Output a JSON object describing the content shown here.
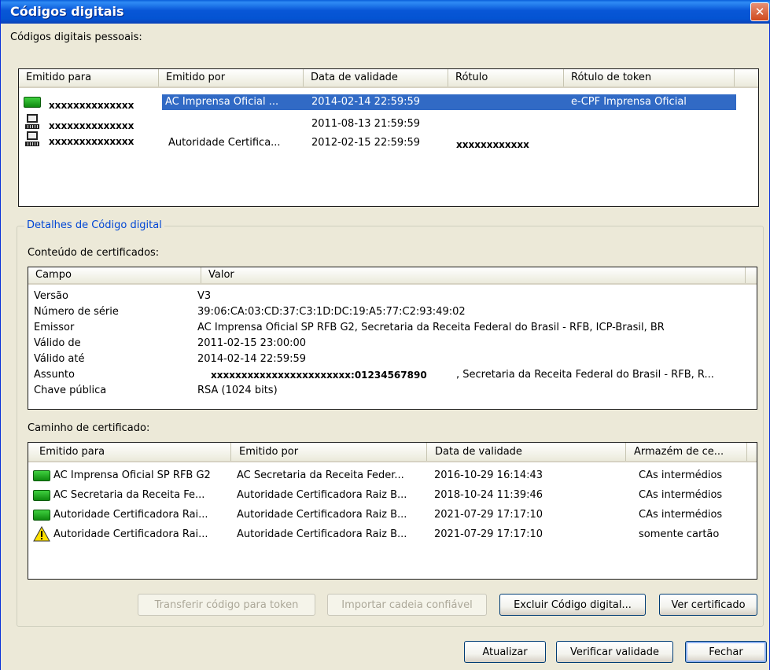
{
  "window": {
    "title": "Códigos digitais",
    "close_glyph": "✕"
  },
  "personal": {
    "label": "Códigos digitais pessoais:",
    "columns": [
      "Emitido para",
      "Emitido por",
      "Data de validade",
      "Rótulo",
      "Rótulo de token"
    ],
    "rows": [
      {
        "icon": "smartcard-icon",
        "issued_to": "xxxxxxxxxxxxxx",
        "issued_by": "AC Imprensa Oficial ...",
        "expires": "2014-02-14 22:59:59",
        "label": "",
        "token_label": "e-CPF Imprensa Oficial",
        "selected": true
      },
      {
        "icon": "computer-icon",
        "issued_to": "xxxxxxxxxxxxxx",
        "issued_by": "",
        "expires": "2011-08-13 21:59:59",
        "label": "",
        "token_label": "",
        "selected": false
      },
      {
        "icon": "computer-icon",
        "issued_to": "xxxxxxxxxxxxxx",
        "issued_by": "Autoridade Certifica...",
        "expires": "2012-02-15 22:59:59",
        "label": "xxxxxxxxxxxx",
        "token_label": "",
        "selected": false
      }
    ]
  },
  "details": {
    "group_title": "Detalhes de Código digital",
    "content_label": "Conteúdo de certificados:",
    "columns": [
      "Campo",
      "Valor"
    ],
    "fields": [
      {
        "field": "Versão",
        "value": "V3"
      },
      {
        "field": "Número de série",
        "value": "39:06:CA:03:CD:37:C3:1D:DC:19:A5:77:C2:93:49:02"
      },
      {
        "field": "Emissor",
        "value": "AC Imprensa Oficial SP RFB G2, Secretaria da Receita Federal do Brasil - RFB, ICP-Brasil, BR"
      },
      {
        "field": "Válido de",
        "value": "2011-02-15 23:00:00"
      },
      {
        "field": "Válido até",
        "value": "2014-02-14 22:59:59"
      },
      {
        "field": "Assunto",
        "value_masked": "xxxxxxxxxxxxxxxxxxxxxxx:01234567890",
        "value": ", Secretaria da Receita Federal do Brasil - RFB, R..."
      },
      {
        "field": "Chave pública",
        "value": "RSA (1024 bits)"
      }
    ],
    "path_label": "Caminho de certificado:",
    "path_columns": [
      "Emitido para",
      "Emitido por",
      "Data de validade",
      "Armazém de ce..."
    ],
    "path_rows": [
      {
        "icon": "smartcard-icon",
        "issued_to": "AC Imprensa Oficial SP RFB G2",
        "issued_by": "AC Secretaria da Receita Feder...",
        "expires": "2016-10-29 16:14:43",
        "store": "CAs intermédios"
      },
      {
        "icon": "smartcard-icon",
        "issued_to": "AC Secretaria da Receita Fe...",
        "issued_by": "Autoridade Certificadora Raiz B...",
        "expires": "2018-10-24 11:39:46",
        "store": "CAs intermédios"
      },
      {
        "icon": "smartcard-icon",
        "issued_to": "Autoridade Certificadora Rai...",
        "issued_by": "Autoridade Certificadora Raiz B...",
        "expires": "2021-07-29 17:17:10",
        "store": "CAs intermédios"
      },
      {
        "icon": "warning-icon",
        "issued_to": "Autoridade Certificadora Rai...",
        "issued_by": "Autoridade Certificadora Raiz B...",
        "expires": "2021-07-29 17:17:10",
        "store": "somente cartão"
      }
    ],
    "buttons": {
      "transfer": "Transferir código para token",
      "import_chain": "Importar cadeia confiável",
      "delete": "Excluir Código digital...",
      "view": "Ver certificado"
    }
  },
  "footer": {
    "refresh": "Atualizar",
    "verify": "Verificar validade",
    "close": "Fechar"
  },
  "colors": {
    "selection": "#316ac5",
    "titlebar": "#0454d2",
    "group_title": "#0046d5",
    "dialog_bg": "#ece9d8"
  }
}
